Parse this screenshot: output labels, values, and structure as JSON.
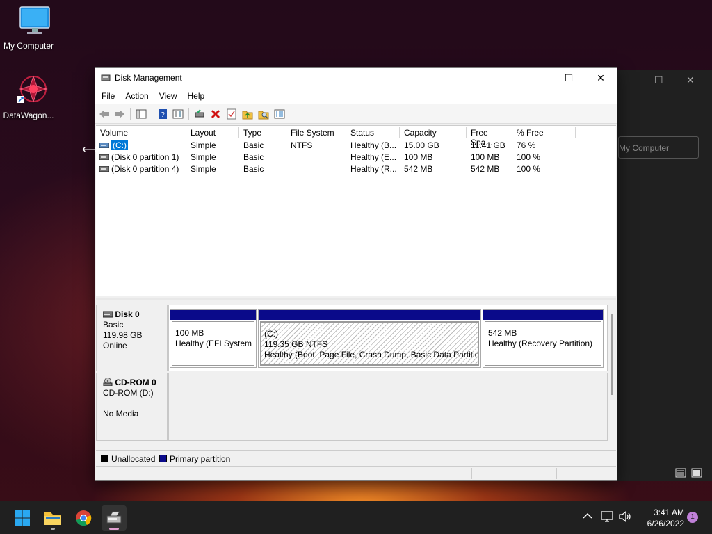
{
  "desktop": {
    "icons": [
      {
        "label": "My Computer",
        "icon": "monitor-icon"
      },
      {
        "label": "DataWagon...",
        "icon": "datawagon-shortcut-icon"
      }
    ]
  },
  "background_window": {
    "address_text": "My Computer"
  },
  "window": {
    "title": "Disk Management",
    "controls": {
      "minimize": "—",
      "maximize": "☐",
      "close": "✕"
    },
    "menu": [
      "File",
      "Action",
      "View",
      "Help"
    ],
    "toolbar_icons": [
      "back-arrow-icon",
      "forward-arrow-icon",
      "console-tree-icon",
      "help-icon",
      "properties-icon",
      "connect-icon",
      "delete-icon",
      "check-icon",
      "folder-up-icon",
      "search-folder-icon",
      "list-icon"
    ]
  },
  "volume_list": {
    "columns": [
      "Volume",
      "Layout",
      "Type",
      "File System",
      "Status",
      "Capacity",
      "Free Spa...",
      "% Free"
    ],
    "rows": [
      {
        "volume": "(C:)",
        "layout": "Simple",
        "type": "Basic",
        "fs": "NTFS",
        "status": "Healthy (B...",
        "capacity": "15.00 GB",
        "free": "11.41 GB",
        "pct": "76 %"
      },
      {
        "volume": "(Disk 0 partition 1)",
        "layout": "Simple",
        "type": "Basic",
        "fs": "",
        "status": "Healthy (E...",
        "capacity": "100 MB",
        "free": "100 MB",
        "pct": "100 %"
      },
      {
        "volume": "(Disk 0 partition 4)",
        "layout": "Simple",
        "type": "Basic",
        "fs": "",
        "status": "Healthy (R...",
        "capacity": "542 MB",
        "free": "542 MB",
        "pct": "100 %"
      }
    ]
  },
  "disks": {
    "disk0": {
      "name": "Disk 0",
      "type": "Basic",
      "size": "119.98 GB",
      "state": "Online",
      "partitions": [
        {
          "title": "",
          "size": "100 MB",
          "status": "Healthy (EFI System Partition)"
        },
        {
          "title": "(C:)",
          "size": "119.35 GB NTFS",
          "status": "Healthy (Boot, Page File, Crash Dump, Basic Data Partition)"
        },
        {
          "title": "",
          "size": "542 MB",
          "status": "Healthy (Recovery Partition)"
        }
      ]
    },
    "cdrom0": {
      "name": "CD-ROM 0",
      "drive": "CD-ROM (D:)",
      "media": "No Media"
    }
  },
  "legend": [
    {
      "label": "Unallocated",
      "color": "#000000"
    },
    {
      "label": "Primary partition",
      "color": "#0a0a8a"
    }
  ],
  "taskbar": {
    "apps": [
      "windows-start-icon",
      "file-explorer-icon",
      "chrome-icon",
      "disk-management-icon"
    ],
    "time": "3:41 AM",
    "date": "6/26/2022",
    "notification_count": "1"
  }
}
